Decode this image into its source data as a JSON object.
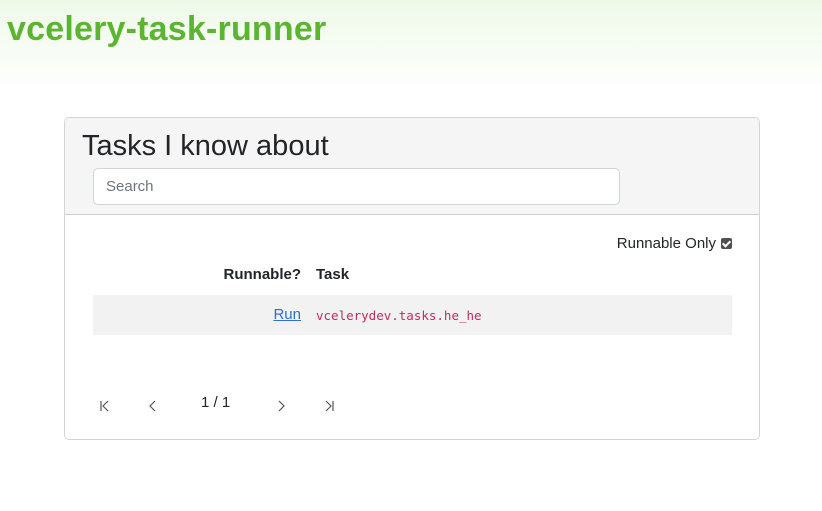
{
  "app": {
    "title": "vcelery-task-runner",
    "brand_color": "#5cb531"
  },
  "card": {
    "title": "Tasks I know about",
    "search": {
      "placeholder": "Search",
      "value": ""
    },
    "filter": {
      "label": "Runnable Only",
      "checked": true
    },
    "table": {
      "columns": [
        "Runnable?",
        "Task"
      ],
      "rows": [
        {
          "action": "Run",
          "task": "vcelerydev.tasks.he_he"
        }
      ]
    },
    "pagination": {
      "status": "1 / 1",
      "icons": [
        "first-page-icon",
        "prev-page-icon",
        "next-page-icon",
        "last-page-icon"
      ]
    }
  }
}
